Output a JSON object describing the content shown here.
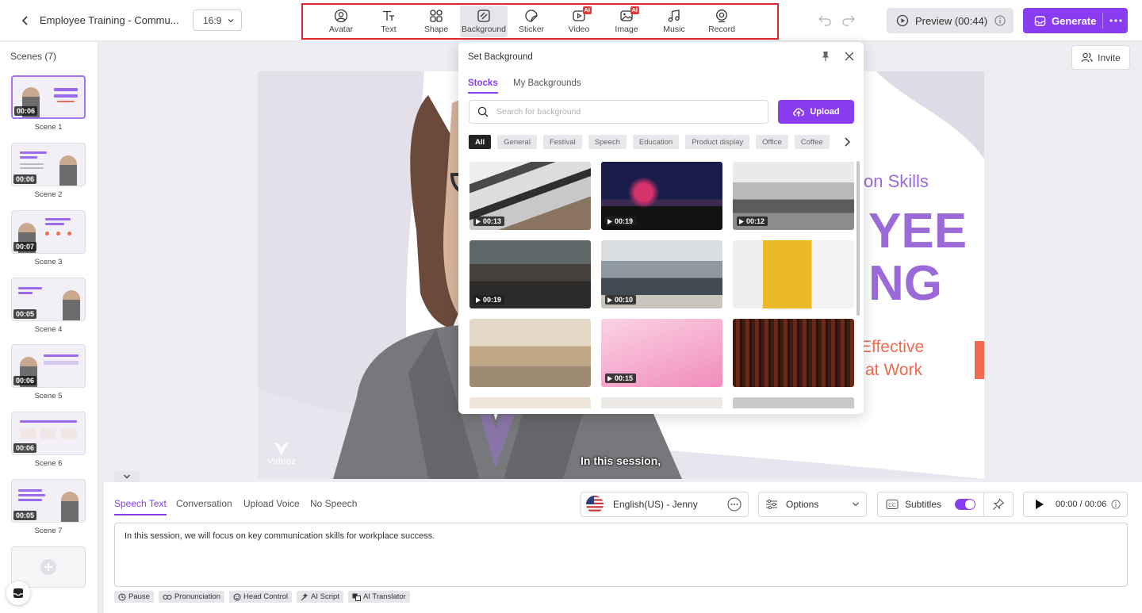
{
  "header": {
    "project_title": "Employee Training - Commu...",
    "aspect_ratio": "16:9",
    "tools": [
      {
        "label": "Avatar",
        "icon": "avatar-icon",
        "ai": false
      },
      {
        "label": "Text",
        "icon": "text-icon",
        "ai": false
      },
      {
        "label": "Shape",
        "icon": "shape-icon",
        "ai": false
      },
      {
        "label": "Background",
        "icon": "background-icon",
        "ai": false,
        "active": true
      },
      {
        "label": "Sticker",
        "icon": "sticker-icon",
        "ai": false
      },
      {
        "label": "Video",
        "icon": "video-icon",
        "ai": true
      },
      {
        "label": "Image",
        "icon": "image-icon",
        "ai": true
      },
      {
        "label": "Music",
        "icon": "music-icon",
        "ai": false
      },
      {
        "label": "Record",
        "icon": "record-icon",
        "ai": false
      }
    ],
    "ai_badge": "AI",
    "preview_label": "Preview (00:44)",
    "generate_label": "Generate"
  },
  "sidebar": {
    "title": "Scenes (7)",
    "scenes": [
      {
        "name": "Scene 1",
        "duration": "00:06",
        "selected": true
      },
      {
        "name": "Scene 2",
        "duration": "00:06"
      },
      {
        "name": "Scene 3",
        "duration": "00:07"
      },
      {
        "name": "Scene 4",
        "duration": "00:05"
      },
      {
        "name": "Scene 5",
        "duration": "00:06"
      },
      {
        "name": "Scene 6",
        "duration": "00:06"
      },
      {
        "name": "Scene 7",
        "duration": "00:05"
      }
    ]
  },
  "invite_label": "Invite",
  "canvas": {
    "line1": "on Skills",
    "line2": "YEE",
    "line3": "NG",
    "line4": "Effective",
    "line5": "at Work",
    "subtitle": "In this session,",
    "watermark": "Vidnoz"
  },
  "popup": {
    "title": "Set Background",
    "tabs": [
      "Stocks",
      "My Backgrounds"
    ],
    "search_placeholder": "Search for background",
    "upload_label": "Upload",
    "categories": [
      "All",
      "General",
      "Festival",
      "Speech",
      "Education",
      "Product display",
      "Office",
      "Coffee"
    ],
    "backgrounds": [
      {
        "duration": "00:13"
      },
      {
        "duration": "00:19"
      },
      {
        "duration": "00:12"
      },
      {
        "duration": "00:19"
      },
      {
        "duration": "00:10"
      },
      {
        "duration": null
      },
      {
        "duration": null
      },
      {
        "duration": "00:15"
      },
      {
        "duration": null
      }
    ]
  },
  "speech": {
    "tabs": [
      "Speech Text",
      "Conversation",
      "Upload Voice",
      "No Speech"
    ],
    "voice": "English(US) - Jenny",
    "options_label": "Options",
    "subtitles_label": "Subtitles",
    "subtitles_on": true,
    "time": "00:00 / 00:06",
    "script_text": "In this session, we will focus on key communication skills for workplace success.",
    "chips": [
      {
        "label": "Pause",
        "icon": "clock-icon"
      },
      {
        "label": "Pronunciation",
        "icon": "link-icon"
      },
      {
        "label": "Head Control",
        "icon": "face-icon"
      },
      {
        "label": "AI Script",
        "icon": "ai-script-icon"
      },
      {
        "label": "AI Translator",
        "icon": "translate-icon"
      }
    ]
  },
  "colors": {
    "accent": "#8a3cf0",
    "title_purple": "#9b6ad8",
    "coral": "#f26a4f",
    "highlight_box": "#e0282c"
  }
}
